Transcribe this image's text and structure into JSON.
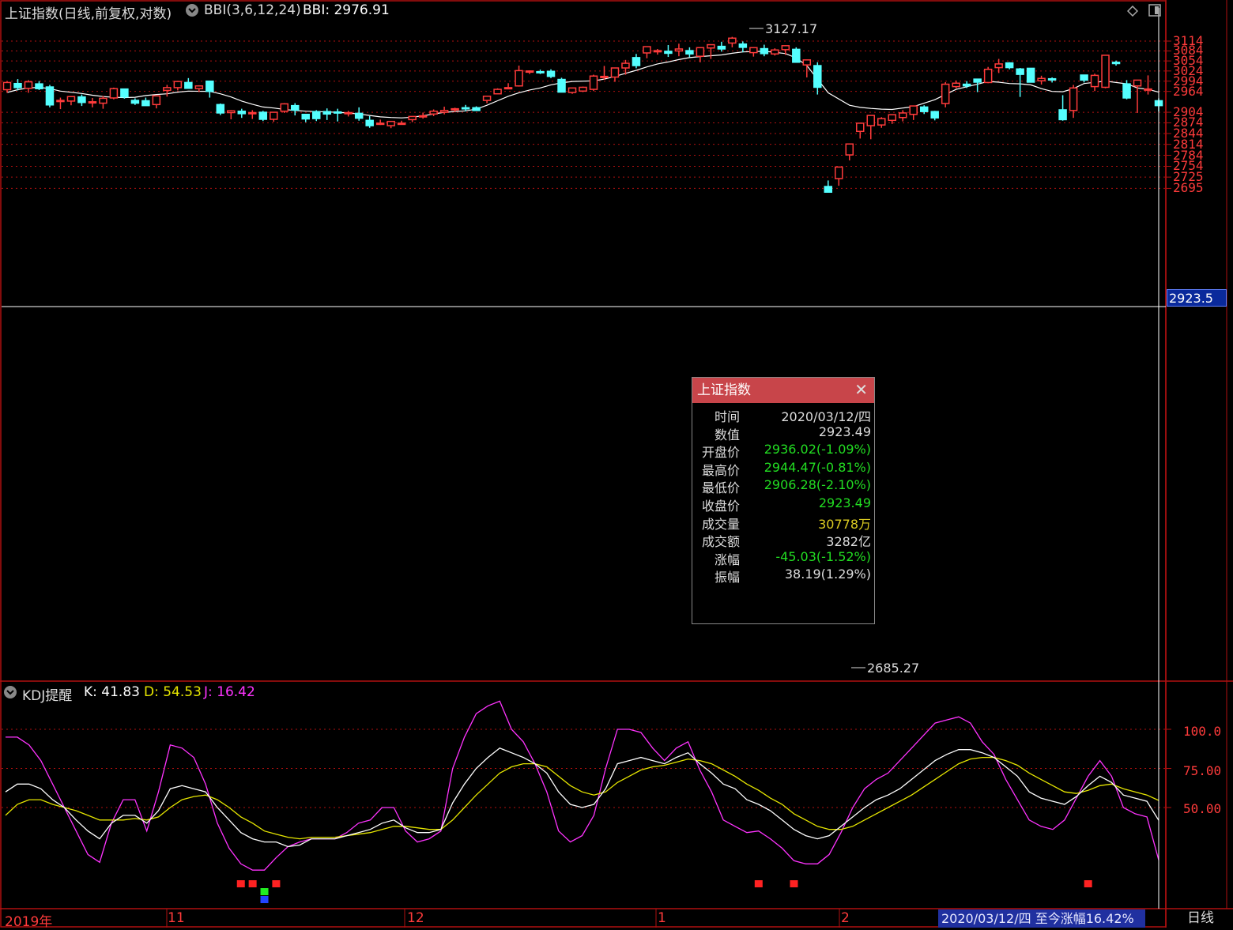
{
  "header": {
    "title": "上证指数(日线,前复权,对数)",
    "indicator_name": "BBI(3,6,12,24)",
    "indicator_value": "BBI: 2976.91"
  },
  "price_axis": [
    "3114",
    "3084",
    "3054",
    "3024",
    "2994",
    "2964",
    "2904",
    "2874",
    "2844",
    "2814",
    "2784",
    "2754",
    "2725",
    "2695"
  ],
  "current_price_box": "2923.5",
  "extremes": {
    "high": "3127.17",
    "low": "2685.27"
  },
  "kdj": {
    "name": "KDJ提醒",
    "k": "K: 41.83",
    "d": "D: 54.53",
    "j": "J: 16.42",
    "axis": [
      "100.0",
      "75.00",
      "50.00"
    ]
  },
  "x_axis": [
    "2019年",
    "11",
    "12",
    "1",
    "2"
  ],
  "status": "2020/03/12/四 至今涨幅16.42%",
  "period": "日线",
  "popup": {
    "title": "上证指数",
    "rows": [
      {
        "label": "时间",
        "value": "2020/03/12/四"
      },
      {
        "label": "数值",
        "value": "2923.49"
      },
      {
        "label": "开盘价",
        "value": "2936.02(-1.09%)"
      },
      {
        "label": "最高价",
        "value": "2944.47(-0.81%)"
      },
      {
        "label": "最低价",
        "value": "2906.28(-2.10%)"
      },
      {
        "label": "收盘价",
        "value": "2923.49"
      },
      {
        "label": "成交量",
        "value": "30778万"
      },
      {
        "label": "成交额",
        "value": "3282亿"
      },
      {
        "label": "涨幅",
        "value": "-45.03(-1.52%)"
      },
      {
        "label": "振幅",
        "value": "38.19(1.29%)"
      }
    ],
    "colors": [
      "#dddddd",
      "#dddddd",
      "#22dd22",
      "#22dd22",
      "#22dd22",
      "#22dd22",
      "#ddcc22",
      "#dddddd",
      "#22dd22",
      "#dddddd"
    ]
  },
  "colors": {
    "up": "#ff3b3b",
    "down": "#54ffff",
    "grid": "#b01010",
    "k": "#ffffff",
    "d": "#e6e600",
    "j": "#ff33ff"
  },
  "candles": [
    [
      2969,
      2993,
      2960,
      2990
    ],
    [
      2987,
      3000,
      2967,
      2975
    ],
    [
      2973,
      2997,
      2960,
      2992
    ],
    [
      2986,
      2994,
      2968,
      2972
    ],
    [
      2977,
      2983,
      2918,
      2925
    ],
    [
      2935,
      2946,
      2913,
      2938
    ],
    [
      2936,
      2948,
      2924,
      2949
    ],
    [
      2948,
      2955,
      2922,
      2932
    ],
    [
      2931,
      2945,
      2918,
      2934
    ],
    [
      2930,
      2951,
      2914,
      2944
    ],
    [
      2945,
      2975,
      2941,
      2972
    ],
    [
      2971,
      2972,
      2943,
      2948
    ],
    [
      2938,
      2944,
      2925,
      2930
    ],
    [
      2937,
      2946,
      2926,
      2923
    ],
    [
      2926,
      2950,
      2915,
      2951
    ],
    [
      2967,
      2983,
      2949,
      2975
    ],
    [
      2975,
      2988,
      2967,
      2993
    ],
    [
      2990,
      3003,
      2972,
      2973
    ],
    [
      2972,
      2982,
      2962,
      2980
    ],
    [
      2994,
      2995,
      2946,
      2964
    ],
    [
      2926,
      2929,
      2896,
      2902
    ],
    [
      2903,
      2910,
      2884,
      2908
    ],
    [
      2907,
      2914,
      2888,
      2900
    ],
    [
      2901,
      2910,
      2885,
      2903
    ],
    [
      2904,
      2908,
      2879,
      2884
    ],
    [
      2884,
      2902,
      2877,
      2904
    ],
    [
      2907,
      2930,
      2902,
      2928
    ],
    [
      2923,
      2930,
      2895,
      2910
    ],
    [
      2898,
      2899,
      2876,
      2885
    ],
    [
      2906,
      2910,
      2879,
      2886
    ],
    [
      2906,
      2915,
      2882,
      2899
    ],
    [
      2905,
      2914,
      2878,
      2904
    ],
    [
      2902,
      2908,
      2892,
      2903
    ],
    [
      2901,
      2918,
      2880,
      2887
    ],
    [
      2881,
      2893,
      2860,
      2866
    ],
    [
      2870,
      2883,
      2868,
      2873
    ],
    [
      2866,
      2879,
      2859,
      2878
    ],
    [
      2871,
      2880,
      2870,
      2873
    ],
    [
      2883,
      2893,
      2876,
      2892
    ],
    [
      2891,
      2903,
      2886,
      2894
    ],
    [
      2899,
      2912,
      2893,
      2907
    ],
    [
      2904,
      2920,
      2898,
      2909
    ],
    [
      2912,
      2917,
      2904,
      2914
    ],
    [
      2917,
      2925,
      2907,
      2914
    ],
    [
      2917,
      2921,
      2910,
      2909
    ],
    [
      2938,
      2947,
      2930,
      2950
    ],
    [
      2957,
      2973,
      2956,
      2970
    ],
    [
      2975,
      2988,
      2971,
      2975
    ],
    [
      2980,
      3040,
      2978,
      3025
    ],
    [
      3021,
      3026,
      3015,
      3024
    ],
    [
      3022,
      3028,
      3015,
      3019
    ],
    [
      3023,
      3029,
      3003,
      3008
    ],
    [
      2999,
      3004,
      2963,
      2962
    ],
    [
      2961,
      2973,
      2957,
      2974
    ],
    [
      2965,
      2978,
      2962,
      2976
    ],
    [
      2970,
      3013,
      2965,
      3009
    ],
    [
      3008,
      3039,
      2998,
      3008
    ],
    [
      3006,
      3014,
      2992,
      3033
    ],
    [
      3033,
      3057,
      3013,
      3047
    ],
    [
      3064,
      3075,
      3032,
      3040
    ],
    [
      3078,
      3095,
      3062,
      3097
    ],
    [
      3085,
      3090,
      3073,
      3085
    ],
    [
      3083,
      3102,
      3066,
      3077
    ],
    [
      3084,
      3106,
      3068,
      3090
    ],
    [
      3085,
      3095,
      3065,
      3075
    ],
    [
      3068,
      3092,
      3050,
      3094
    ],
    [
      3093,
      3103,
      3060,
      3103
    ],
    [
      3098,
      3112,
      3082,
      3090
    ],
    [
      3108,
      3127,
      3095,
      3123
    ],
    [
      3105,
      3113,
      3080,
      3095
    ],
    [
      3079,
      3092,
      3067,
      3094
    ],
    [
      3091,
      3103,
      3068,
      3076
    ],
    [
      3075,
      3092,
      3070,
      3087
    ],
    [
      3088,
      3101,
      3072,
      3100
    ],
    [
      3089,
      3095,
      3050,
      3050
    ],
    [
      3042,
      3054,
      3005,
      3057
    ],
    [
      3040,
      3050,
      2955,
      2976
    ],
    [
      2700,
      2716,
      2685,
      2685
    ],
    [
      2721,
      2746,
      2702,
      2752
    ],
    [
      2785,
      2808,
      2770,
      2815
    ],
    [
      2850,
      2865,
      2830,
      2873
    ],
    [
      2866,
      2895,
      2828,
      2895
    ],
    [
      2868,
      2890,
      2860,
      2886
    ],
    [
      2881,
      2898,
      2871,
      2897
    ],
    [
      2889,
      2910,
      2878,
      2902
    ],
    [
      2898,
      2919,
      2882,
      2922
    ],
    [
      2919,
      2924,
      2899,
      2906
    ],
    [
      2906,
      2908,
      2881,
      2888
    ],
    [
      2929,
      2991,
      2918,
      2985
    ],
    [
      2978,
      2996,
      2973,
      2988
    ],
    [
      2985,
      2994,
      2974,
      2980
    ],
    [
      3000,
      3000,
      2962,
      2991
    ],
    [
      2990,
      3036,
      2988,
      3029
    ],
    [
      3034,
      3060,
      3018,
      3045
    ],
    [
      3048,
      3050,
      3029,
      3034
    ],
    [
      3030,
      3033,
      2948,
      3014
    ],
    [
      3032,
      3025,
      2996,
      2991
    ],
    [
      2995,
      3010,
      2984,
      3002
    ],
    [
      3001,
      3005,
      2990,
      2999
    ],
    [
      2911,
      2953,
      2880,
      2883
    ],
    [
      2909,
      2983,
      2888,
      2974
    ],
    [
      3012,
      3013,
      2990,
      2997
    ],
    [
      2978,
      3016,
      2965,
      3011
    ],
    [
      2976,
      3057,
      2973,
      3071
    ],
    [
      3050,
      3055,
      3040,
      3046
    ],
    [
      2986,
      2997,
      2941,
      2945
    ],
    [
      2980,
      2993,
      2902,
      2997
    ],
    [
      2968,
      3011,
      2955,
      2971
    ],
    [
      2937,
      2944,
      2906,
      2923
    ]
  ],
  "bbi": [
    2961,
    2969,
    2974,
    2976,
    2972,
    2965,
    2958,
    2953,
    2949,
    2947,
    2946,
    2947,
    2952,
    2955,
    2957,
    2962,
    2965,
    2964,
    2957,
    2948,
    2936,
    2927,
    2919,
    2916,
    2912,
    2909,
    2907,
    2906,
    2904,
    2902,
    2899,
    2895,
    2891,
    2889,
    2888,
    2890,
    2894,
    2899,
    2904,
    2908,
    2913,
    2924,
    2937,
    2950,
    2960,
    2968,
    2974,
    2983,
    2989,
    2993,
    2995,
    3000,
    3008,
    3017,
    3026,
    3036,
    3045,
    3051,
    3058,
    3064,
    3067,
    3072,
    3077,
    3081,
    3082,
    3083,
    3080,
    3076,
    3063,
    3040,
    3000,
    2960,
    2924,
    2918,
    2915,
    2913,
    2912,
    2916,
    2920,
    2930,
    2940,
    2955,
    2970,
    2985,
    2993,
    2991,
    2987,
    2986,
    2983,
    2972,
    2964,
    2963,
    2972,
    2987,
    2994,
    2990,
    2986,
    2974,
    2970,
    2962
  ],
  "kdj_series": {
    "k": [
      60,
      65,
      65,
      62,
      55,
      50,
      42,
      35,
      30,
      40,
      45,
      45,
      40,
      48,
      62,
      64,
      62,
      60,
      50,
      42,
      34,
      30,
      28,
      28,
      25,
      26,
      30,
      30,
      30,
      32,
      34,
      36,
      40,
      42,
      37,
      34,
      34,
      36,
      53,
      65,
      75,
      82,
      88,
      85,
      82,
      78,
      72,
      60,
      52,
      50,
      52,
      62,
      78,
      80,
      82,
      80,
      78,
      82,
      85,
      78,
      72,
      65,
      62,
      55,
      52,
      48,
      42,
      36,
      32,
      30,
      32,
      38,
      44,
      50,
      55,
      58,
      62,
      68,
      74,
      80,
      84,
      87,
      87,
      85,
      82,
      76,
      70,
      60,
      56,
      54,
      52,
      57,
      64,
      70,
      66,
      58,
      56,
      54,
      41.83
    ],
    "d": [
      45,
      52,
      55,
      55,
      52,
      50,
      48,
      45,
      42,
      42,
      42,
      43,
      42,
      44,
      50,
      55,
      57,
      58,
      55,
      50,
      44,
      40,
      35,
      33,
      31,
      30,
      31,
      31,
      31,
      32,
      33,
      34,
      36,
      38,
      38,
      37,
      36,
      36,
      42,
      50,
      58,
      65,
      72,
      76,
      78,
      78,
      76,
      70,
      64,
      60,
      58,
      60,
      66,
      70,
      74,
      76,
      77,
      79,
      81,
      80,
      78,
      74,
      70,
      65,
      61,
      56,
      52,
      46,
      42,
      38,
      36,
      36,
      38,
      42,
      46,
      50,
      54,
      58,
      63,
      68,
      73,
      78,
      81,
      82,
      82,
      80,
      77,
      72,
      68,
      64,
      60,
      59,
      61,
      64,
      65,
      62,
      60,
      58,
      54.53
    ],
    "j": [
      95,
      95,
      90,
      80,
      65,
      50,
      35,
      20,
      15,
      40,
      55,
      55,
      35,
      60,
      90,
      88,
      82,
      65,
      40,
      24,
      14,
      10,
      10,
      18,
      25,
      28,
      30,
      30,
      30,
      34,
      40,
      42,
      50,
      50,
      35,
      28,
      30,
      35,
      75,
      95,
      110,
      115,
      118,
      100,
      92,
      78,
      60,
      35,
      28,
      32,
      45,
      75,
      100,
      100,
      98,
      88,
      80,
      88,
      92,
      74,
      60,
      42,
      38,
      34,
      35,
      30,
      24,
      16,
      14,
      14,
      20,
      34,
      50,
      62,
      68,
      72,
      80,
      88,
      96,
      104,
      106,
      108,
      104,
      92,
      84,
      68,
      55,
      42,
      38,
      36,
      42,
      56,
      70,
      80,
      70,
      50,
      46,
      44,
      16.42
    ]
  },
  "kdj_markers": [
    {
      "idx": 20,
      "type": "red"
    },
    {
      "idx": 21,
      "type": "red"
    },
    {
      "idx": 22,
      "type": "green"
    },
    {
      "idx": 22,
      "type": "blue"
    },
    {
      "idx": 23,
      "type": "red"
    },
    {
      "idx": 64,
      "type": "red"
    },
    {
      "idx": 67,
      "type": "red"
    },
    {
      "idx": 92,
      "type": "red"
    }
  ]
}
